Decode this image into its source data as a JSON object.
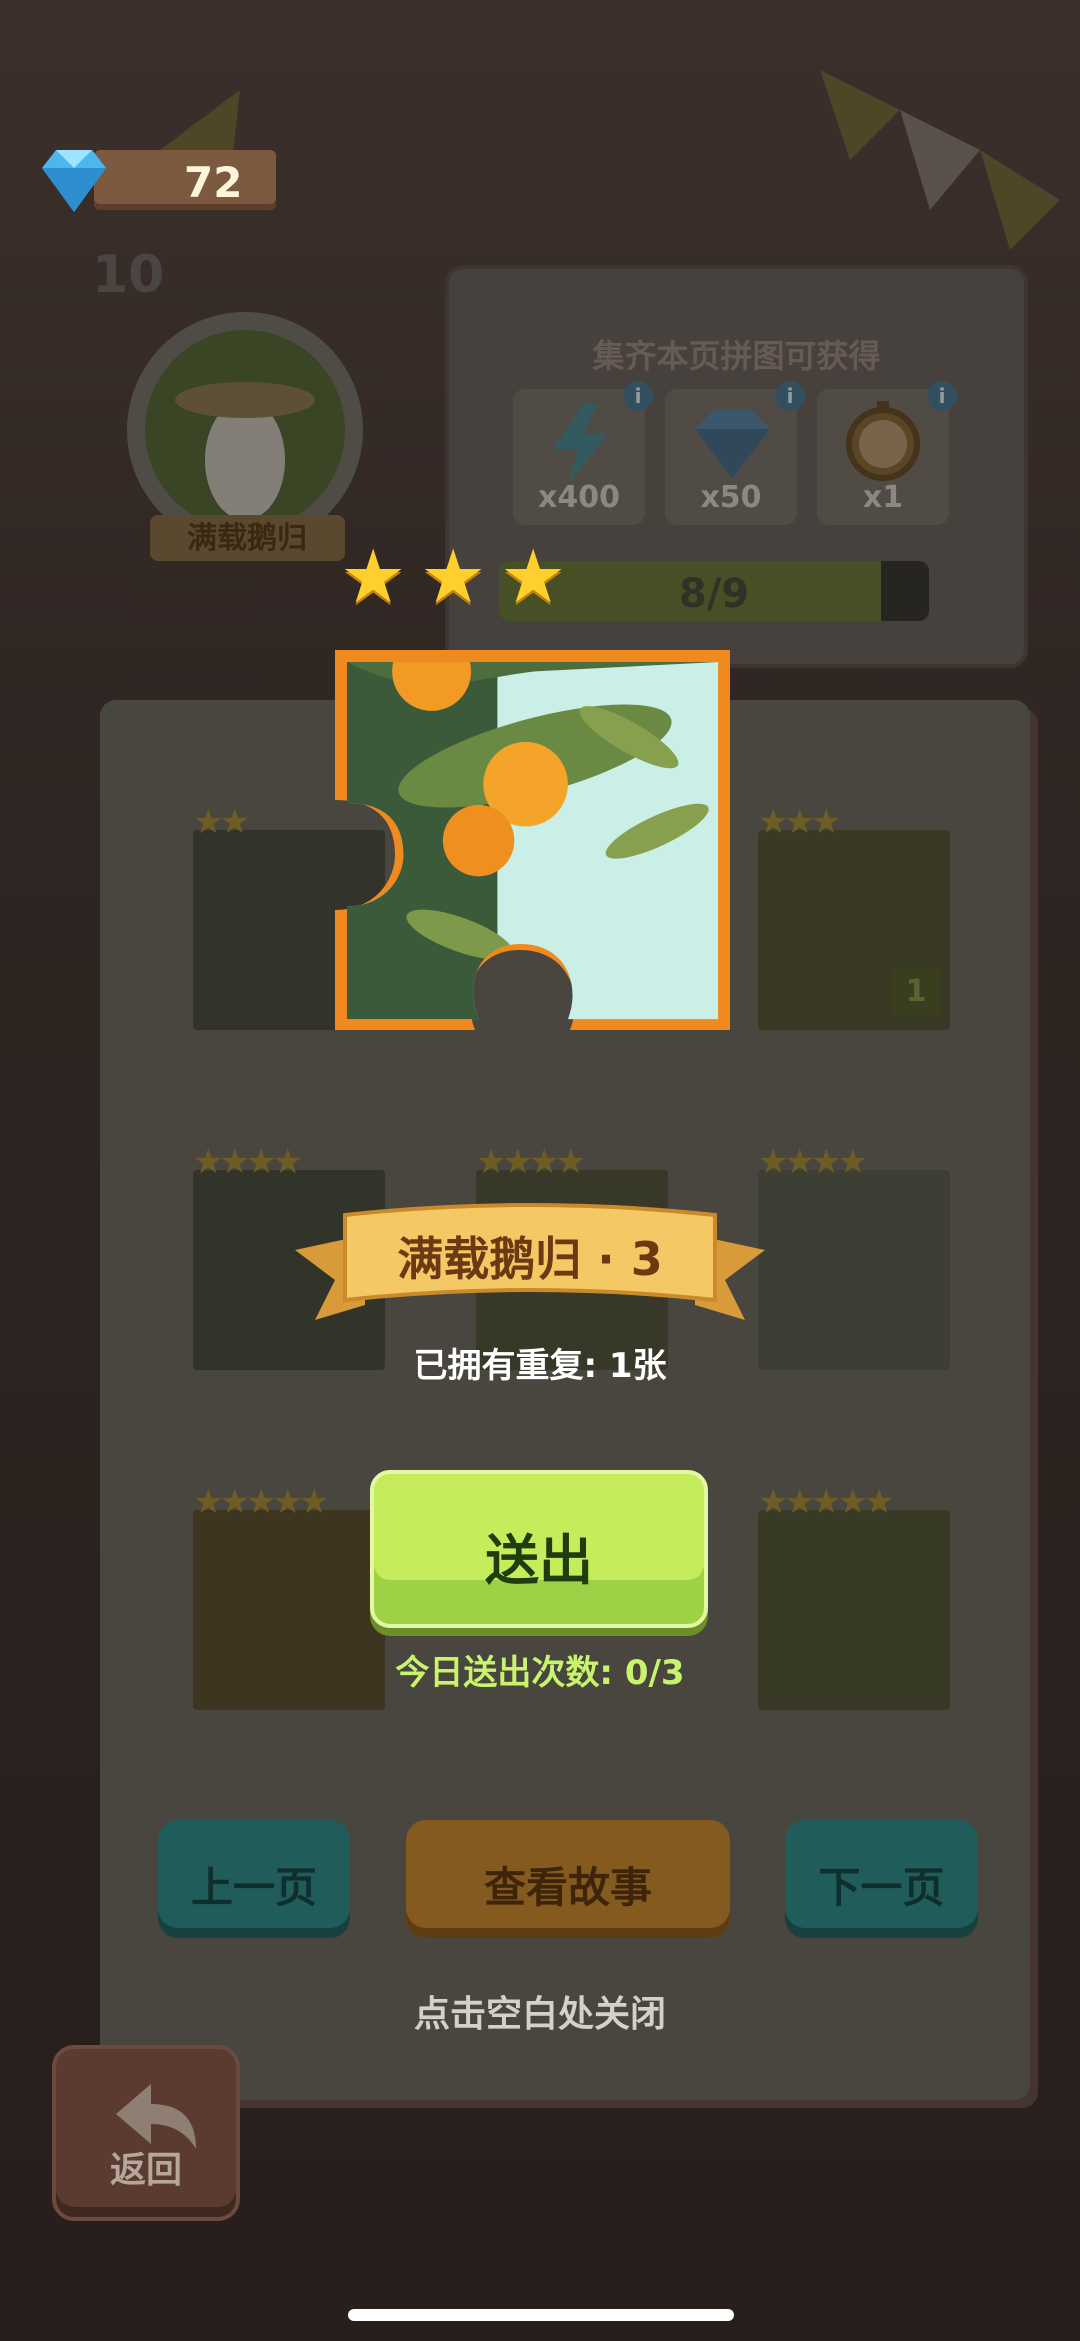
{
  "header": {
    "gems": "72",
    "gem_icon": "diamond-icon"
  },
  "album": {
    "page_number": "10",
    "badge_title": "满载鹅归",
    "reward_title": "集齐本页拼图可获得",
    "rewards": [
      {
        "icon": "lightning-icon",
        "amount": "x400"
      },
      {
        "icon": "diamond-icon",
        "amount": "x50"
      },
      {
        "icon": "stopwatch-icon",
        "amount": "x1"
      }
    ],
    "progress_text": "8/9",
    "progress_fraction": 0.889
  },
  "pieces": [
    {
      "stars": "★★"
    },
    {
      "stars": "★★★",
      "dup": "1"
    },
    {
      "stars": "★★★★"
    },
    {
      "stars": "★★★★"
    },
    {
      "stars": "★★★★"
    },
    {
      "stars": "★★★★★"
    },
    {
      "stars": "★★★★★"
    }
  ],
  "modal": {
    "stars": 3,
    "piece_name": "满载鹅归 · 3",
    "owned_text": "已拥有重复: 1张",
    "send_label": "送出",
    "send_count": "今日送出次数: 0/3"
  },
  "nav": {
    "prev": "上一页",
    "story": "查看故事",
    "next": "下一页"
  },
  "close_hint": "点击空白处关闭",
  "back_label": "返回",
  "colors": {
    "accent_green": "#c5ed5b",
    "star_gold": "#ffcf2e",
    "ribbon": "#f5c866"
  }
}
